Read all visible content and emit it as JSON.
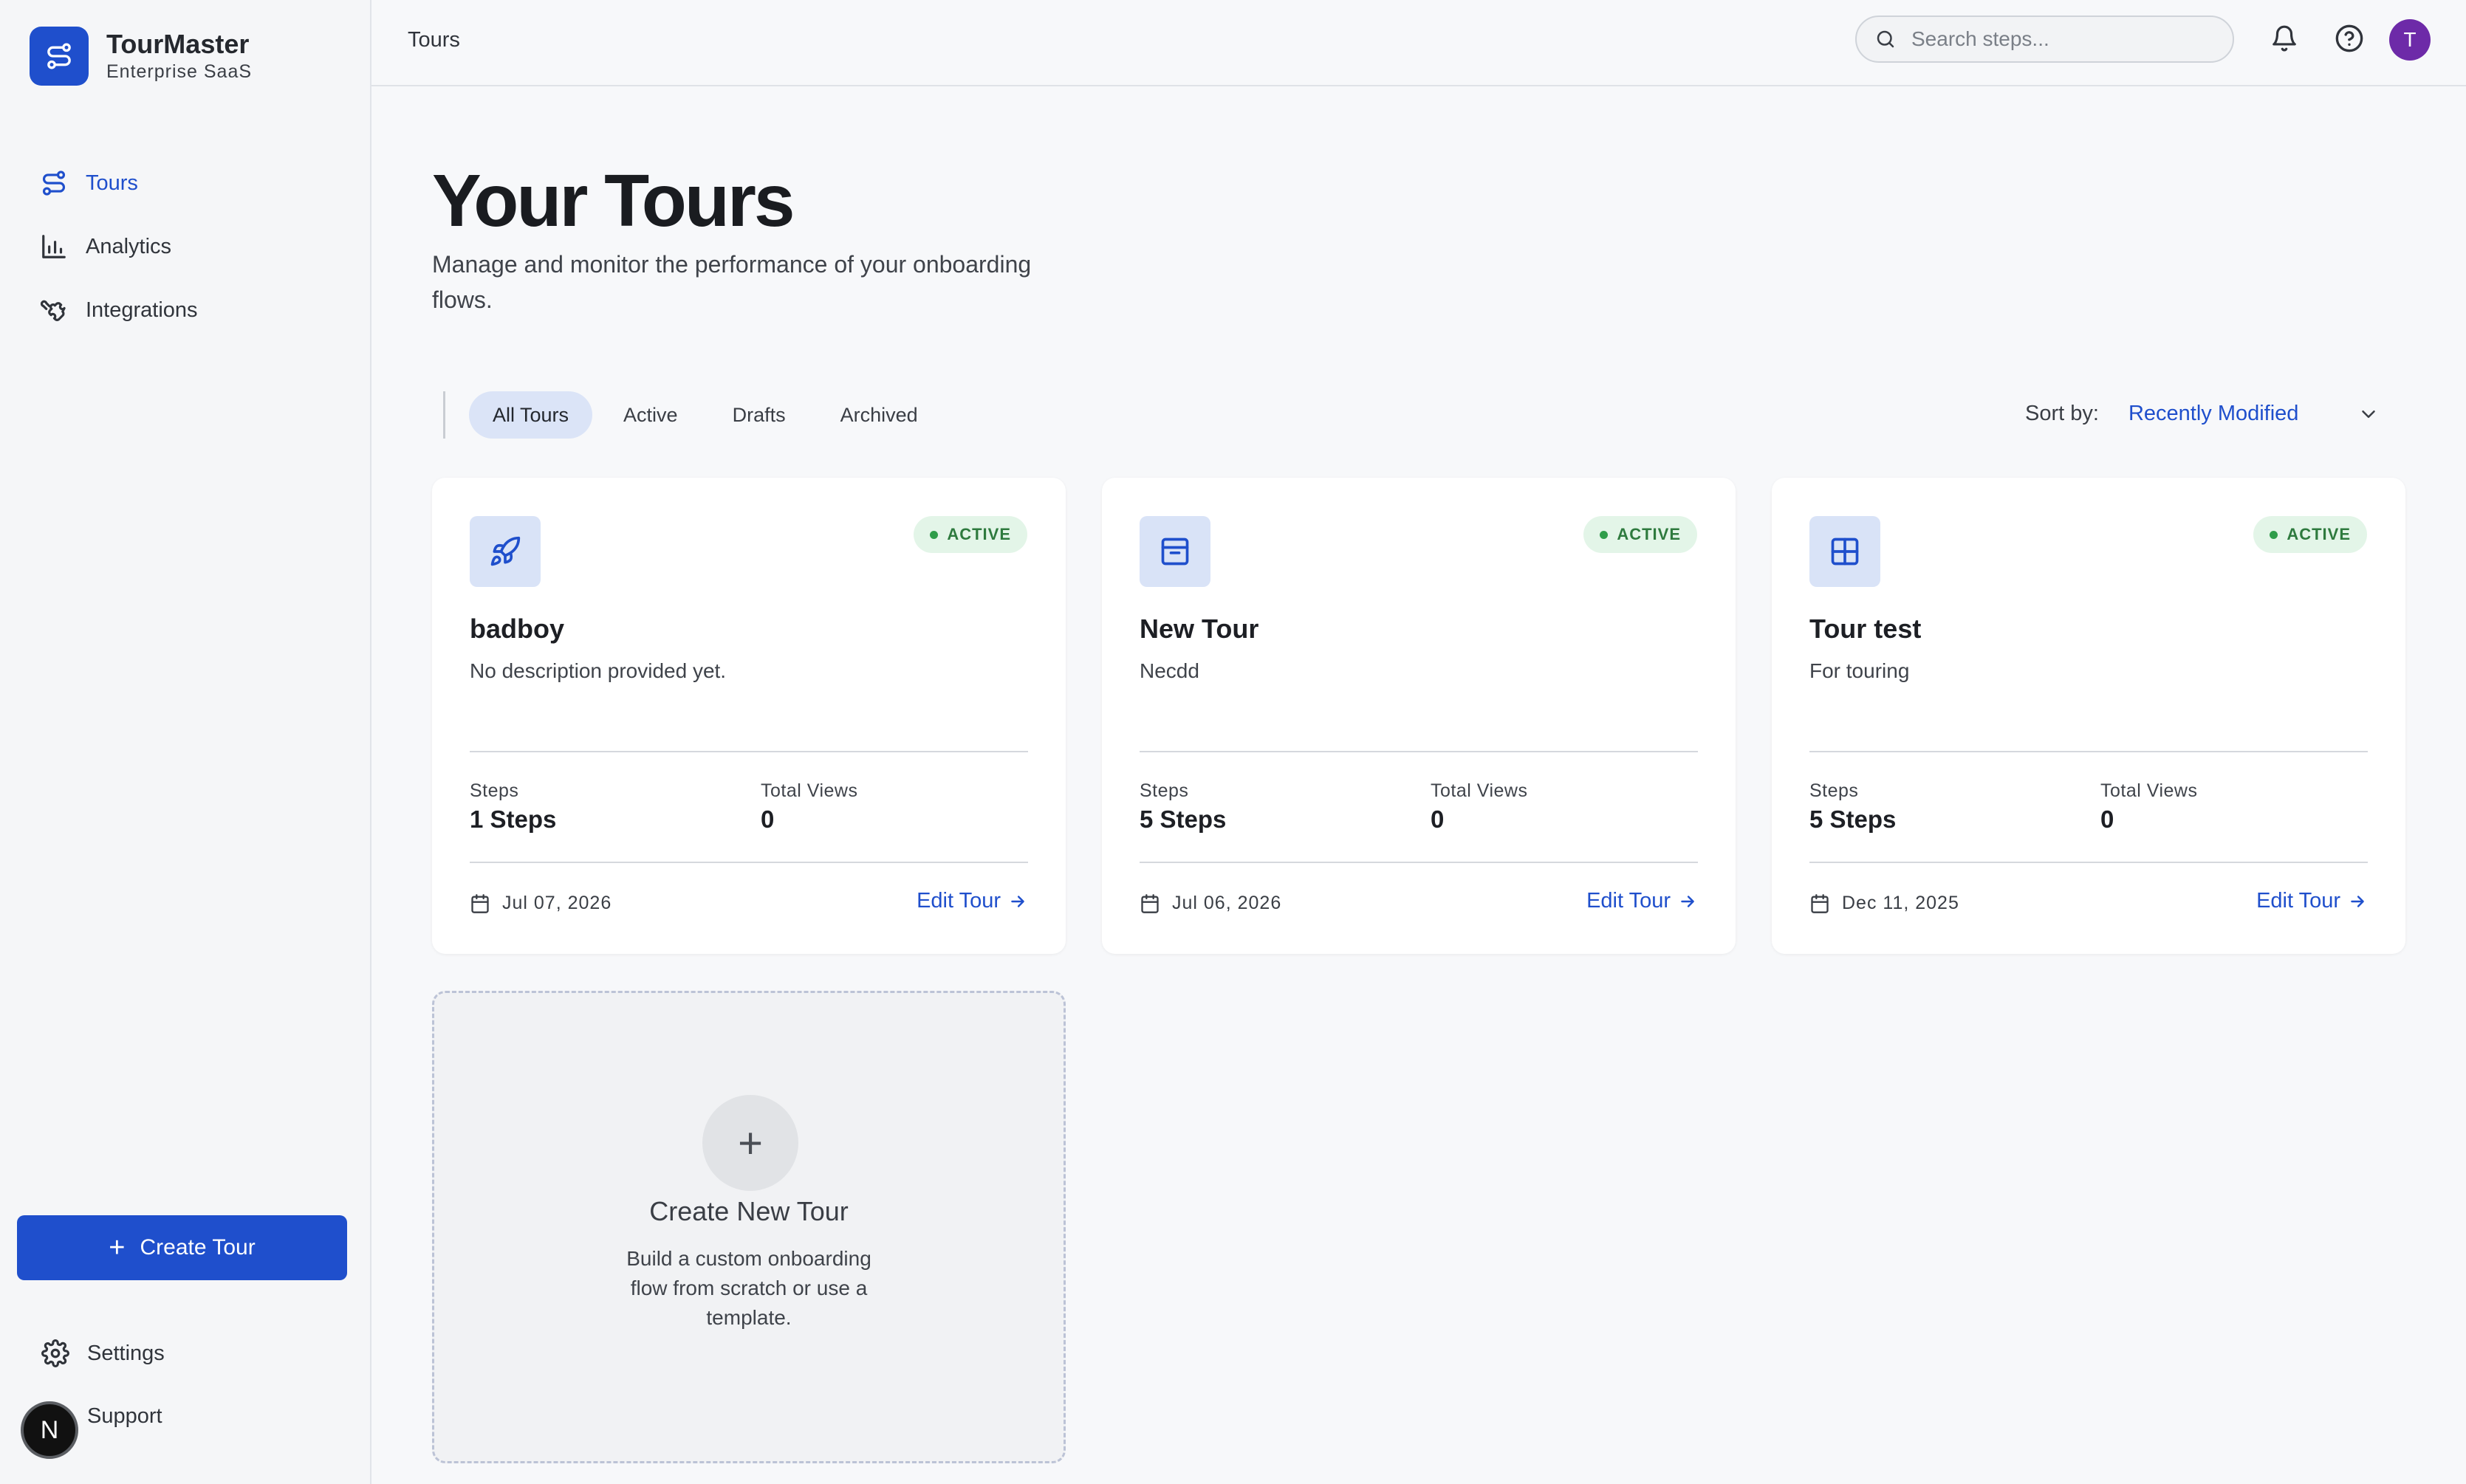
{
  "brand": {
    "name": "TourMaster",
    "subtitle": "Enterprise SaaS",
    "logo_icon": "route-icon",
    "accent": "#1f4fcc"
  },
  "sidebar": {
    "items": [
      {
        "label": "Tours",
        "icon": "route-icon",
        "active": true
      },
      {
        "label": "Analytics",
        "icon": "bar-chart-icon",
        "active": false
      },
      {
        "label": "Integrations",
        "icon": "puzzle-icon",
        "active": false
      }
    ],
    "create_button": "Create Tour",
    "settings": "Settings",
    "support": "Support",
    "badge_letter": "N"
  },
  "topbar": {
    "breadcrumb": "Tours",
    "search_placeholder": "Search steps...",
    "user_initial": "T"
  },
  "main": {
    "title": "Your Tours",
    "subtitle": "Manage and monitor the performance of your onboarding flows.",
    "filters": [
      "All Tours",
      "Active",
      "Drafts",
      "Archived"
    ],
    "active_filter": "All Tours",
    "sort_label": "Sort by:",
    "sort_value": "Recently Modified"
  },
  "tours": [
    {
      "icon": "rocket-icon",
      "status": "ACTIVE",
      "name": "badboy",
      "description": "No description provided yet.",
      "steps_label": "Steps",
      "steps": "1 Steps",
      "views_label": "Total Views",
      "views": "0",
      "date": "Jul 07, 2026",
      "edit": "Edit Tour"
    },
    {
      "icon": "inbox-icon",
      "status": "ACTIVE",
      "name": "New Tour",
      "description": "Necdd",
      "steps_label": "Steps",
      "steps": "5 Steps",
      "views_label": "Total Views",
      "views": "0",
      "date": "Jul 06, 2026",
      "edit": "Edit Tour"
    },
    {
      "icon": "grid-icon",
      "status": "ACTIVE",
      "name": "Tour test",
      "description": "For touring",
      "steps_label": "Steps",
      "steps": "5 Steps",
      "views_label": "Total Views",
      "views": "0",
      "date": "Dec 11, 2025",
      "edit": "Edit Tour"
    }
  ],
  "new_tour": {
    "title": "Create New Tour",
    "description": "Build a custom onboarding flow from scratch or use a template."
  }
}
